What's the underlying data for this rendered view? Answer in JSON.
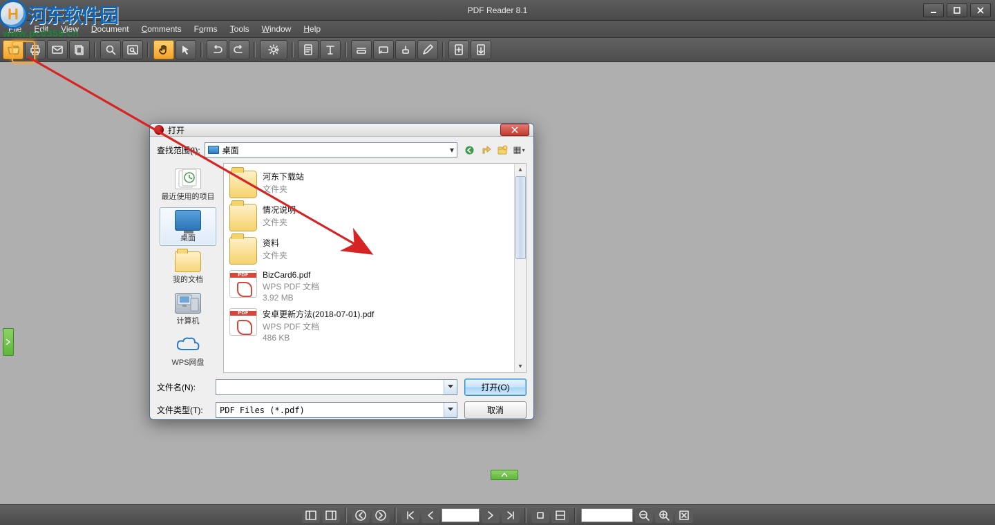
{
  "app": {
    "title": "PDF Reader 8.1"
  },
  "watermark": {
    "chars": "河东软件园",
    "url": "www.pc0359.cn",
    "circle_letter": "H"
  },
  "menu": {
    "file": "File",
    "edit": "Edit",
    "view": "View",
    "document": "Document",
    "comments": "Comments",
    "forms": "Forms",
    "tools": "Tools",
    "window": "Window",
    "help": "Help"
  },
  "toolbar_icons": [
    "open-folder-icon",
    "print-icon",
    "email-icon",
    "copy-icon",
    "find-icon",
    "search-panel-icon",
    "hand-tool-icon",
    "select-tool-icon",
    "undo-icon",
    "redo-icon",
    "settings-gear-icon",
    "page-icon",
    "text-icon",
    "highlight-icon",
    "highlight-area-icon",
    "stamp-icon",
    "pencil-icon",
    "insert-page-icon",
    "extract-page-icon"
  ],
  "statusbar_icons": [
    "panel-left-icon",
    "panel-right-icon",
    "nav-back-icon",
    "nav-forward-icon",
    "first-page-icon",
    "prev-page-icon",
    "next-page-icon",
    "last-page-icon",
    "stop-icon",
    "fit-page-icon",
    "zoom-out-icon",
    "zoom-in-icon",
    "zoom-fit-icon"
  ],
  "statusbar": {
    "page": "",
    "zoom": ""
  },
  "dialog": {
    "title": "打开",
    "look_in_label": "查找范围(I):",
    "look_in_value": "桌面",
    "nav_icons": [
      "web-back-icon",
      "up-one-level-icon",
      "new-folder-icon",
      "views-icon"
    ],
    "places": [
      {
        "label": "最近使用的项目",
        "icon": "recent"
      },
      {
        "label": "桌面",
        "icon": "monitor",
        "selected": true
      },
      {
        "label": "我的文档",
        "icon": "folder"
      },
      {
        "label": "计算机",
        "icon": "pc"
      },
      {
        "label": "WPS网盘",
        "icon": "cloud"
      }
    ],
    "files": [
      {
        "name": "河东下载站",
        "type": "文件夹",
        "kind": "folder"
      },
      {
        "name": "情况说明",
        "type": "文件夹",
        "kind": "folder"
      },
      {
        "name": "资料",
        "type": "文件夹",
        "kind": "folder"
      },
      {
        "name": "BizCard6.pdf",
        "type": "WPS PDF 文档",
        "size": "3.92 MB",
        "kind": "pdf"
      },
      {
        "name": "安卓更新方法(2018-07-01).pdf",
        "type": "WPS PDF 文档",
        "size": "486 KB",
        "kind": "pdf"
      }
    ],
    "filename_label": "文件名(N):",
    "filename_value": "",
    "filetype_label": "文件类型(T):",
    "filetype_value": "PDF Files (*.pdf)",
    "open_btn": "打开(O)",
    "cancel_btn": "取消"
  }
}
